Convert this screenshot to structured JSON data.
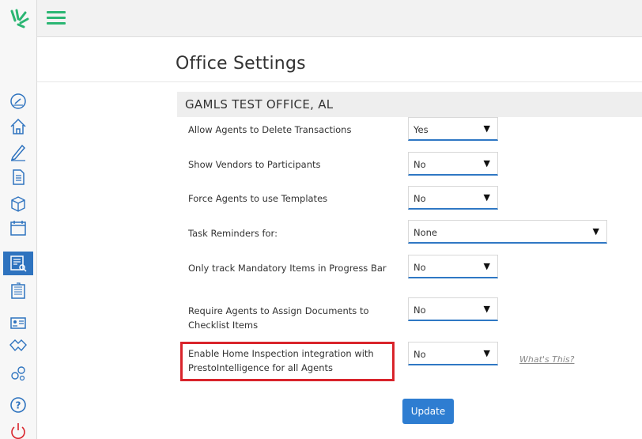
{
  "page": {
    "title": "Office Settings"
  },
  "office": {
    "name": "GAMLS TEST OFFICE, AL"
  },
  "settings": [
    {
      "label": "Allow Agents to Delete Transactions",
      "value": "Yes"
    },
    {
      "label": "Show Vendors to Participants",
      "value": "No"
    },
    {
      "label": "Force Agents to use Templates",
      "value": "No"
    },
    {
      "label": "Task Reminders for:",
      "value": "None"
    },
    {
      "label": "Only track Mandatory Items in Progress Bar",
      "value": "No"
    },
    {
      "label": "Require Agents to Assign Documents to Checklist Items",
      "value": "No"
    },
    {
      "label": "Enable Home Inspection integration with PrestoIntelligence for all Agents",
      "value": "No"
    }
  ],
  "links": {
    "whats_this": "What's This?"
  },
  "actions": {
    "update_label": "Update"
  },
  "icons": {
    "caret": "▼",
    "sidebar": [
      "speedometer-icon",
      "home-icon",
      "pen-icon",
      "document-icon",
      "box-icon",
      "calendar-icon",
      "report-search-icon",
      "office-building-icon",
      "contact-card-icon",
      "handshake-icon",
      "gears-icon",
      "help-icon",
      "power-icon"
    ]
  },
  "colors": {
    "accent": "#2e7dd1",
    "brand_green": "#2bb673",
    "highlight": "#d9242b",
    "active_nav": "#2e73bf"
  }
}
